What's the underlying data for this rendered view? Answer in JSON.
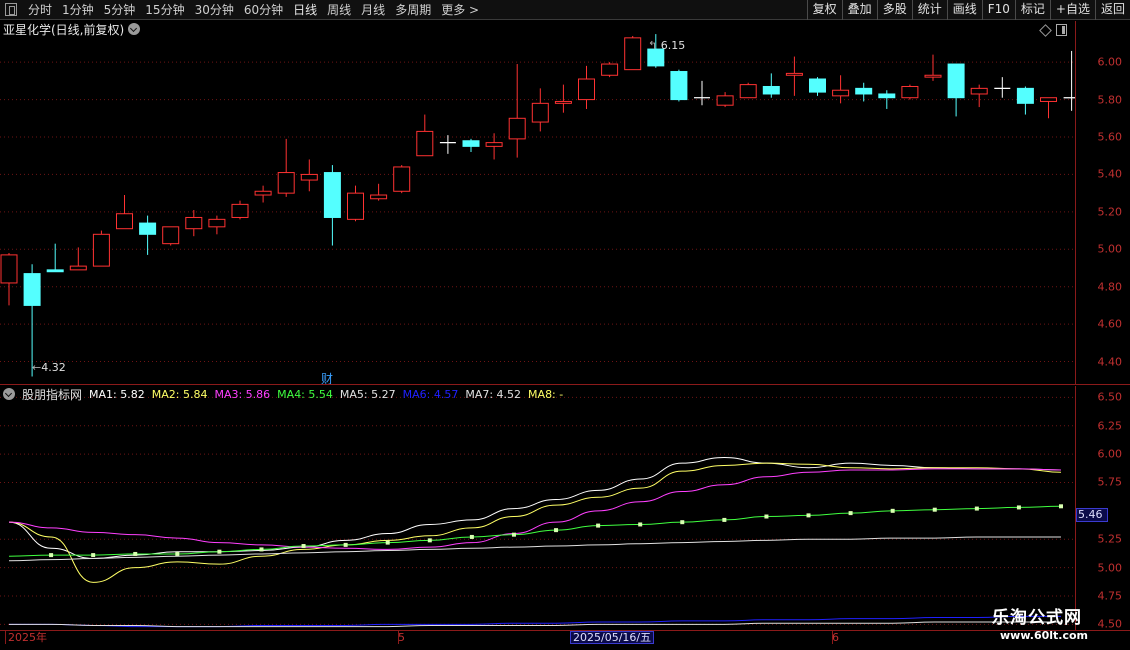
{
  "toolbar": {
    "periods": [
      "分时",
      "1分钟",
      "5分钟",
      "15分钟",
      "30分钟",
      "60分钟",
      "日线",
      "周线",
      "月线",
      "多周期",
      "更多 >"
    ],
    "actions": [
      "复权",
      "叠加",
      "多股",
      "统计",
      "画线",
      "F10",
      "标记",
      "+自选",
      "返回"
    ]
  },
  "chart": {
    "title": "亚星化学(日线,前复权)",
    "high_label": "6.15",
    "low_label": "4.32",
    "finance_mark": "财"
  },
  "main_axis": [
    "6.00",
    "5.80",
    "5.60",
    "5.40",
    "5.20",
    "5.00",
    "4.80",
    "4.60",
    "4.40"
  ],
  "indicator": {
    "name": "股朋指标网",
    "ma": [
      {
        "label": "MA1:",
        "value": "5.82",
        "color": "#ffffff"
      },
      {
        "label": "MA2:",
        "value": "5.84",
        "color": "#ffff66"
      },
      {
        "label": "MA3:",
        "value": "5.86",
        "color": "#ff40ff"
      },
      {
        "label": "MA4:",
        "value": "5.54",
        "color": "#40ff40"
      },
      {
        "label": "MA5:",
        "value": "5.27",
        "color": "#e0e0e0"
      },
      {
        "label": "MA6:",
        "value": "4.57",
        "color": "#2020ff"
      },
      {
        "label": "MA7:",
        "value": "4.52",
        "color": "#e0e0e0"
      },
      {
        "label": "MA8:",
        "value": "-",
        "color": "#ffff66"
      }
    ]
  },
  "sub_axis": [
    "6.50",
    "6.25",
    "6.00",
    "5.75",
    "5.25",
    "5.00",
    "4.75",
    "4.50"
  ],
  "sub_axis_current": "5.46",
  "date_axis": {
    "labels": [
      "2025年",
      "5",
      "6"
    ],
    "current": "2025/05/16/五"
  },
  "watermark": {
    "title": "乐淘公式网",
    "url": "www.60lt.com"
  },
  "colors": {
    "up": "#ff3232",
    "down": "#54ffff",
    "axis": "#8b1a1a"
  },
  "chart_data": {
    "type": "candlestick",
    "price_range": [
      4.28,
      6.22
    ],
    "candles": [
      {
        "o": 4.82,
        "c": 4.97,
        "h": 4.98,
        "l": 4.7
      },
      {
        "o": 4.87,
        "c": 4.7,
        "h": 4.92,
        "l": 4.32
      },
      {
        "o": 4.89,
        "c": 4.88,
        "h": 5.03,
        "l": 4.88
      },
      {
        "o": 4.89,
        "c": 4.91,
        "h": 5.01,
        "l": 4.89
      },
      {
        "o": 4.91,
        "c": 5.08,
        "h": 5.1,
        "l": 4.91
      },
      {
        "o": 5.11,
        "c": 5.19,
        "h": 5.29,
        "l": 5.11
      },
      {
        "o": 5.14,
        "c": 5.08,
        "h": 5.18,
        "l": 4.97
      },
      {
        "o": 5.03,
        "c": 5.12,
        "h": 5.12,
        "l": 5.02
      },
      {
        "o": 5.11,
        "c": 5.17,
        "h": 5.21,
        "l": 5.07
      },
      {
        "o": 5.12,
        "c": 5.16,
        "h": 5.18,
        "l": 5.08
      },
      {
        "o": 5.17,
        "c": 5.24,
        "h": 5.26,
        "l": 5.16
      },
      {
        "o": 5.29,
        "c": 5.31,
        "h": 5.34,
        "l": 5.25
      },
      {
        "o": 5.3,
        "c": 5.41,
        "h": 5.59,
        "l": 5.28
      },
      {
        "o": 5.37,
        "c": 5.4,
        "h": 5.48,
        "l": 5.31
      },
      {
        "o": 5.41,
        "c": 5.17,
        "h": 5.45,
        "l": 5.02
      },
      {
        "o": 5.16,
        "c": 5.3,
        "h": 5.34,
        "l": 5.15
      },
      {
        "o": 5.27,
        "c": 5.29,
        "h": 5.35,
        "l": 5.26
      },
      {
        "o": 5.31,
        "c": 5.44,
        "h": 5.45,
        "l": 5.3
      },
      {
        "o": 5.5,
        "c": 5.63,
        "h": 5.72,
        "l": 5.5
      },
      {
        "o": 5.57,
        "c": 5.57,
        "h": 5.61,
        "l": 5.51
      },
      {
        "o": 5.58,
        "c": 5.55,
        "h": 5.59,
        "l": 5.52
      },
      {
        "o": 5.55,
        "c": 5.57,
        "h": 5.62,
        "l": 5.48
      },
      {
        "o": 5.59,
        "c": 5.7,
        "h": 5.99,
        "l": 5.49
      },
      {
        "o": 5.68,
        "c": 5.78,
        "h": 5.86,
        "l": 5.63
      },
      {
        "o": 5.78,
        "c": 5.79,
        "h": 5.88,
        "l": 5.73
      },
      {
        "o": 5.8,
        "c": 5.91,
        "h": 5.98,
        "l": 5.75
      },
      {
        "o": 5.93,
        "c": 5.99,
        "h": 6.0,
        "l": 5.92
      },
      {
        "o": 5.96,
        "c": 6.13,
        "h": 6.14,
        "l": 5.96
      },
      {
        "o": 6.07,
        "c": 5.98,
        "h": 6.15,
        "l": 5.97
      },
      {
        "o": 5.95,
        "c": 5.8,
        "h": 5.96,
        "l": 5.79
      },
      {
        "o": 5.81,
        "c": 5.81,
        "h": 5.9,
        "l": 5.77
      },
      {
        "o": 5.77,
        "c": 5.82,
        "h": 5.84,
        "l": 5.76
      },
      {
        "o": 5.81,
        "c": 5.88,
        "h": 5.89,
        "l": 5.81
      },
      {
        "o": 5.87,
        "c": 5.83,
        "h": 5.94,
        "l": 5.81
      },
      {
        "o": 5.93,
        "c": 5.94,
        "h": 6.03,
        "l": 5.82
      },
      {
        "o": 5.91,
        "c": 5.84,
        "h": 5.92,
        "l": 5.82
      },
      {
        "o": 5.82,
        "c": 5.85,
        "h": 5.93,
        "l": 5.78
      },
      {
        "o": 5.86,
        "c": 5.83,
        "h": 5.89,
        "l": 5.79
      },
      {
        "o": 5.83,
        "c": 5.81,
        "h": 5.85,
        "l": 5.75
      },
      {
        "o": 5.81,
        "c": 5.87,
        "h": 5.88,
        "l": 5.8
      },
      {
        "o": 5.92,
        "c": 5.93,
        "h": 6.04,
        "l": 5.9
      },
      {
        "o": 5.99,
        "c": 5.81,
        "h": 5.99,
        "l": 5.71
      },
      {
        "o": 5.83,
        "c": 5.86,
        "h": 5.88,
        "l": 5.76
      },
      {
        "o": 5.86,
        "c": 5.86,
        "h": 5.92,
        "l": 5.81
      },
      {
        "o": 5.86,
        "c": 5.78,
        "h": 5.87,
        "l": 5.72
      },
      {
        "o": 5.79,
        "c": 5.81,
        "h": 5.81,
        "l": 5.7
      },
      {
        "o": 5.81,
        "c": 5.81,
        "h": 6.06,
        "l": 5.74
      }
    ],
    "indicator_range": [
      4.45,
      6.6
    ],
    "indicator_series": [
      {
        "name": "MA1",
        "color": "#ffffff",
        "values": [
          5.4,
          5.17,
          5.08,
          5.11,
          5.14,
          5.14,
          5.15,
          5.18,
          5.24,
          5.3,
          5.38,
          5.42,
          5.52,
          5.6,
          5.68,
          5.78,
          5.92,
          5.97,
          5.92,
          5.88,
          5.92,
          5.9,
          5.88,
          5.87,
          5.87,
          5.86
        ]
      },
      {
        "name": "MA2",
        "color": "#ffff66",
        "values": [
          5.4,
          5.27,
          4.87,
          5.0,
          5.05,
          5.03,
          5.1,
          5.16,
          5.2,
          5.24,
          5.28,
          5.35,
          5.45,
          5.55,
          5.62,
          5.7,
          5.85,
          5.9,
          5.92,
          5.91,
          5.88,
          5.87,
          5.88,
          5.88,
          5.87,
          5.84
        ]
      },
      {
        "name": "MA3",
        "color": "#ff40ff",
        "values": [
          5.4,
          5.35,
          5.31,
          5.29,
          5.26,
          5.22,
          5.2,
          5.18,
          5.17,
          5.16,
          5.18,
          5.22,
          5.3,
          5.4,
          5.5,
          5.58,
          5.67,
          5.73,
          5.8,
          5.84,
          5.86,
          5.86,
          5.87,
          5.87,
          5.87,
          5.86
        ]
      },
      {
        "name": "MA4",
        "color": "#40ff40",
        "values": [
          5.1,
          5.11,
          5.11,
          5.12,
          5.12,
          5.14,
          5.16,
          5.19,
          5.2,
          5.22,
          5.24,
          5.27,
          5.29,
          5.33,
          5.37,
          5.38,
          5.4,
          5.42,
          5.45,
          5.46,
          5.48,
          5.5,
          5.51,
          5.52,
          5.53,
          5.54
        ]
      },
      {
        "name": "MA5",
        "color": "#e0e0e0",
        "values": [
          5.06,
          5.07,
          5.08,
          5.09,
          5.1,
          5.11,
          5.12,
          5.13,
          5.14,
          5.15,
          5.16,
          5.17,
          5.18,
          5.19,
          5.2,
          5.21,
          5.22,
          5.23,
          5.24,
          5.25,
          5.25,
          5.26,
          5.26,
          5.27,
          5.27,
          5.27
        ]
      },
      {
        "name": "MA6",
        "color": "#2020ff",
        "values": [
          4.5,
          4.5,
          4.49,
          4.48,
          4.48,
          4.48,
          4.49,
          4.49,
          4.49,
          4.5,
          4.5,
          4.5,
          4.51,
          4.51,
          4.52,
          4.52,
          4.53,
          4.53,
          4.54,
          4.54,
          4.55,
          4.55,
          4.56,
          4.56,
          4.57,
          4.57
        ]
      },
      {
        "name": "MA7",
        "color": "#e0e0e0",
        "values": [
          4.5,
          4.5,
          4.49,
          4.49,
          4.48,
          4.48,
          4.48,
          4.48,
          4.48,
          4.48,
          4.49,
          4.49,
          4.49,
          4.49,
          4.5,
          4.5,
          4.5,
          4.5,
          4.51,
          4.51,
          4.51,
          4.51,
          4.52,
          4.52,
          4.52,
          4.52
        ]
      }
    ]
  }
}
